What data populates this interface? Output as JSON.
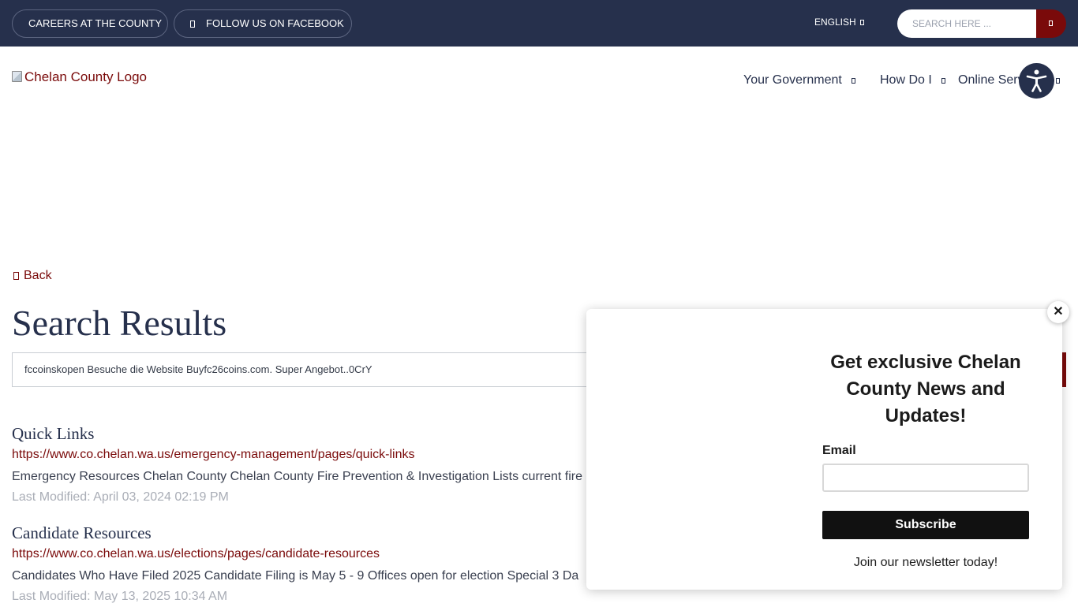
{
  "topbar": {
    "careers_label": "CAREERS AT THE COUNTY",
    "facebook_label": "FOLLOW US ON FACEBOOK",
    "language_label": "ENGLISH",
    "search_placeholder": "SEARCH HERE ...",
    "bar_color": "#26304c",
    "accent_color": "#7a0a0a"
  },
  "header": {
    "logo_alt": "Chelan County Logo",
    "nav": [
      {
        "label": "Your Government"
      },
      {
        "label": "How Do I"
      },
      {
        "label": "Online Services"
      }
    ],
    "accessibility_icon": "accessibility-icon"
  },
  "main": {
    "back_label": "Back",
    "title": "Search Results",
    "query": "fccoinskopen Besuche die Website Buyfc26coins.com. Super Angebot..0CrY",
    "results": [
      {
        "title": "Quick Links",
        "url": "https://www.co.chelan.wa.us/emergency-management/pages/quick-links",
        "description": "Emergency Resources Chelan County   Chelan County Fire Prevention & Investigation Lists current fire",
        "modified": "Last Modified: April 03, 2024 02:19 PM"
      },
      {
        "title": "Candidate Resources",
        "url": "https://www.co.chelan.wa.us/elections/pages/candidate-resources",
        "description": "Candidates Who Have Filed 2025 Candidate Filing is May 5 - 9 Offices open for election   Special 3 Da",
        "modified": "Last Modified: May 13, 2025 10:34 AM"
      }
    ]
  },
  "popup": {
    "close_label": "✕",
    "heading": "Get exclusive Chelan County News and Updates!",
    "email_label": "Email",
    "email_value": "",
    "subscribe_label": "Subscribe",
    "footer_text": "Join our newsletter today!"
  }
}
